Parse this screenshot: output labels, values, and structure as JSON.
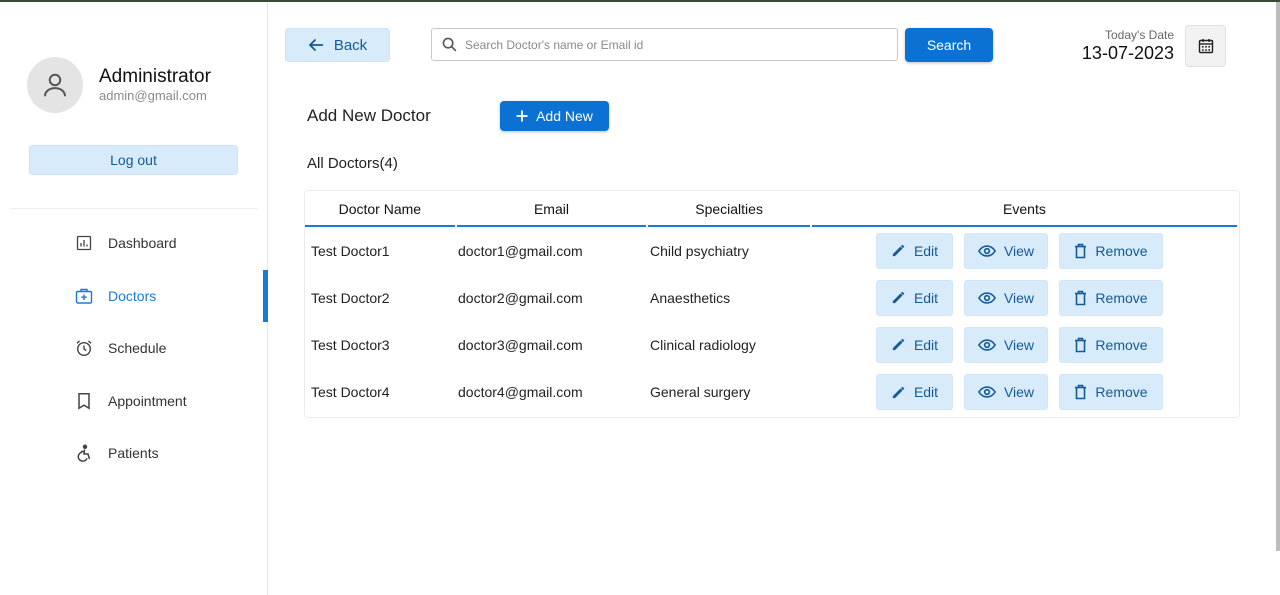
{
  "profile": {
    "name": "Administrator",
    "email": "admin@gmail.com"
  },
  "sidebar": {
    "logout_label": "Log out",
    "items": [
      {
        "label": "Dashboard",
        "icon": "dashboard-icon"
      },
      {
        "label": "Doctors",
        "icon": "medical-bag-icon",
        "active": true
      },
      {
        "label": "Schedule",
        "icon": "alarm-clock-icon"
      },
      {
        "label": "Appointment",
        "icon": "bookmark-icon"
      },
      {
        "label": "Patients",
        "icon": "accessible-icon"
      }
    ]
  },
  "header": {
    "back_label": "Back",
    "search_placeholder": "Search Doctor's name or Email id",
    "search_value": "",
    "search_button": "Search",
    "date_label": "Today's Date",
    "date_value": "13-07-2023"
  },
  "main": {
    "add_label": "Add New Doctor",
    "add_button": "Add New",
    "all_title": "All Doctors(4)",
    "columns": [
      "Doctor Name",
      "Email",
      "Specialties",
      "Events"
    ],
    "rows": [
      {
        "name": "Test Doctor1",
        "email": "doctor1@gmail.com",
        "specialty": "Child psychiatry"
      },
      {
        "name": "Test Doctor2",
        "email": "doctor2@gmail.com",
        "specialty": "Anaesthetics"
      },
      {
        "name": "Test Doctor3",
        "email": "doctor3@gmail.com",
        "specialty": "Clinical radiology"
      },
      {
        "name": "Test Doctor4",
        "email": "doctor4@gmail.com",
        "specialty": "General surgery"
      }
    ],
    "actions": {
      "edit": "Edit",
      "view": "View",
      "remove": "Remove"
    }
  },
  "colors": {
    "accent": "#0b72d4",
    "accent_light": "#d8ebfa",
    "accent_text": "#155a96"
  }
}
